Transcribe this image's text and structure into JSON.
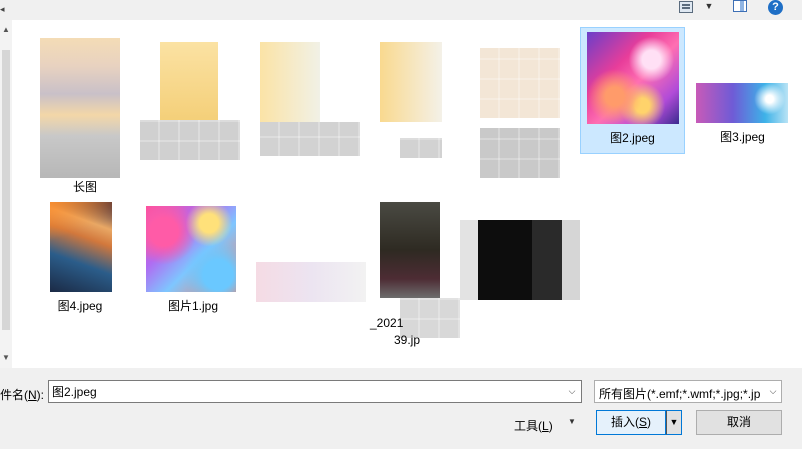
{
  "toolbar": {
    "view_icon": "list-view-icon",
    "pane_icon": "preview-pane-icon",
    "help_icon": "?"
  },
  "files": [
    {
      "name": "长图",
      "kind": "image-blurred"
    },
    {
      "name": "",
      "kind": "folder"
    },
    {
      "name": "",
      "kind": "folder"
    },
    {
      "name": "",
      "kind": "folder"
    },
    {
      "name": "",
      "kind": "image-blurred"
    },
    {
      "name": "图2.jpeg",
      "kind": "image",
      "selected": true
    },
    {
      "name": "图3.jpeg",
      "kind": "image"
    },
    {
      "name": "图4.jpeg",
      "kind": "image"
    },
    {
      "name": "图片1.jpg",
      "kind": "image"
    },
    {
      "name": "",
      "kind": "image-blurred"
    },
    {
      "name": "_2021",
      "name2": "39.jp",
      "kind": "image-blurred"
    },
    {
      "name": "",
      "kind": "image-blurred"
    }
  ],
  "bottom": {
    "filename_label": "件名(",
    "filename_key": "N",
    "filename_label_end": "):",
    "filename_value": "图2.jpeg",
    "filter_text": "所有图片(*.emf;*.wmf;*.jpg;*.jp",
    "tools_label": "工具(",
    "tools_key": "L",
    "tools_label_end": ")",
    "insert_label": "插入(",
    "insert_key": "S",
    "insert_label_end": ")",
    "cancel_label": "取消"
  }
}
